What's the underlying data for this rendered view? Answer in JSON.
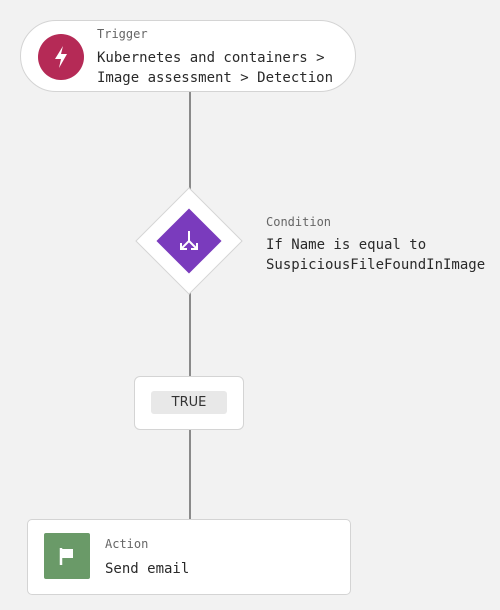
{
  "trigger": {
    "label": "Trigger",
    "line1": "Kubernetes and containers >",
    "line2": "Image assessment > Detection",
    "icon": "lightning-bolt-icon",
    "color": "#b52a56"
  },
  "condition": {
    "label": "Condition",
    "line1": "If Name is equal to",
    "line2": "SuspiciousFileFoundInImage",
    "icon": "branch-split-icon",
    "color": "#7a3bbd"
  },
  "branch": {
    "label": "TRUE"
  },
  "action": {
    "label": "Action",
    "text": "Send email",
    "icon": "flag-icon",
    "color": "#6a9a68"
  }
}
